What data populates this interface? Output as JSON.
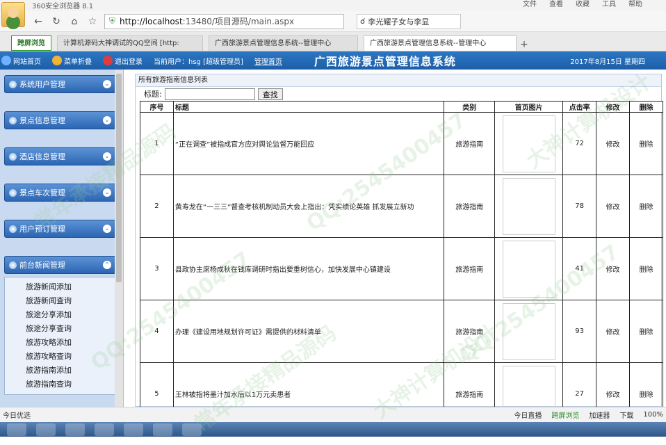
{
  "browser": {
    "app_title": "360安全浏览器 8.1",
    "menus": [
      "文件",
      "查看",
      "收藏",
      "工具",
      "帮助"
    ],
    "url_host": "http://localhost",
    "url_path": ":13480/项目源码/main.aspx",
    "search_text": "李光耀子女与李显",
    "tabs": [
      {
        "label": "跨屏浏览",
        "style": "green"
      },
      {
        "label": "计算机源码大神调试的QQ空间 [http:",
        "style": "normal"
      },
      {
        "label": "广西旅游景点管理信息系统--管理中心",
        "style": "normal"
      },
      {
        "label": "广西旅游景点管理信息系统--管理中心",
        "style": "active"
      }
    ]
  },
  "header": {
    "site_home": "网站首页",
    "collapse": "菜单折叠",
    "logout": "退出登录",
    "current_user": "当前用户：hsg [超级管理员]",
    "admin_home": "管理首页",
    "system_title": "广西旅游景点管理信息系统",
    "date": "2017年8月15日 星期四"
  },
  "sidebar": {
    "menus": [
      "系统用户管理",
      "景点信息管理",
      "酒店信息管理",
      "景点车次管理",
      "用户预订管理",
      "前台新闻管理"
    ],
    "submenu": [
      "旅游新闻添加",
      "旅游新闻查询",
      "旅途分享添加",
      "旅途分享查询",
      "旅游攻略添加",
      "旅游攻略查询",
      "旅游指南添加",
      "旅游指南查询"
    ]
  },
  "panel": {
    "title": "所有旅游指南信息列表",
    "search_label": "标题:",
    "search_button": "查找",
    "columns": [
      "序号",
      "标题",
      "类别",
      "首页图片",
      "点击率",
      "修改",
      "删除"
    ],
    "rows": [
      {
        "no": "1",
        "title": "“正在调查”被指成官方应对舆论监督万能回应",
        "category": "旅游指南",
        "clicks": "72",
        "edit": "修改",
        "del": "删除"
      },
      {
        "no": "2",
        "title": "黄寿龙在“一三三”督查考核机制动员大会上指出：凭实绩论英雄 抓发展立新功",
        "category": "旅游指南",
        "clicks": "78",
        "edit": "修改",
        "del": "删除"
      },
      {
        "no": "3",
        "title": "县政协主席杨成秋在钱库调研时指出要重树信心，加快发展中心镇建设",
        "category": "旅游指南",
        "clicks": "41",
        "edit": "修改",
        "del": "删除"
      },
      {
        "no": "4",
        "title": "办理《建设用地规划许可证》需提供的材料清单",
        "category": "旅游指南",
        "clicks": "93",
        "edit": "修改",
        "del": "删除"
      },
      {
        "no": "5",
        "title": "王林被指将墨汁加水后以1万元卖患者",
        "category": "旅游指南",
        "clicks": "27",
        "edit": "修改",
        "del": "删除"
      }
    ]
  },
  "statusbar": {
    "left": "今日优选",
    "items": [
      "今日直播",
      "跨屏浏览",
      "加速器",
      "下载",
      "100%"
    ]
  },
  "watermark": [
    "QQ:2545400457",
    "大神计算机设计",
    "常年承接精品源码"
  ]
}
